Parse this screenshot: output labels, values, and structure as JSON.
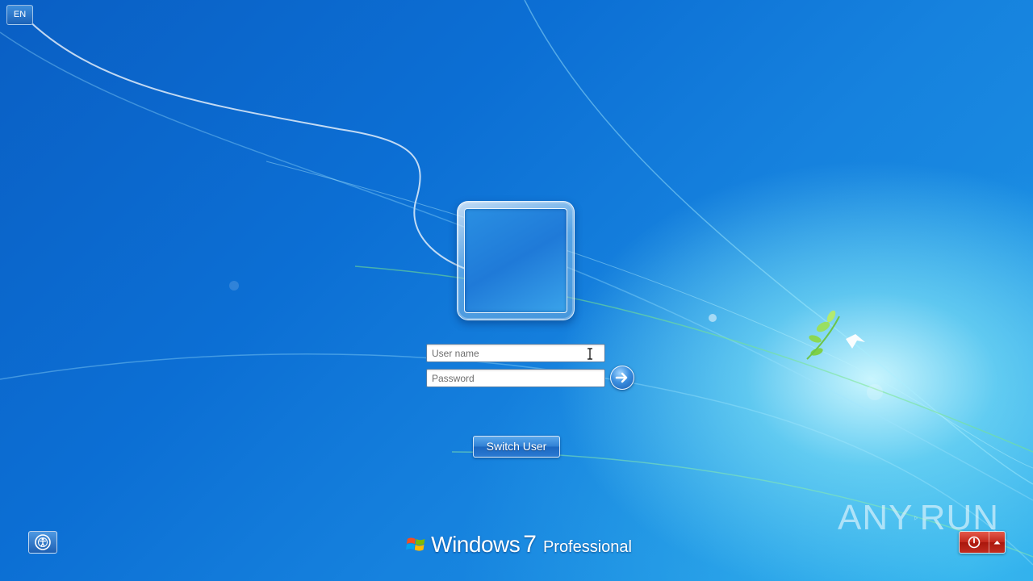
{
  "language_bar": {
    "label": "EN"
  },
  "login": {
    "username_placeholder": "User name",
    "password_placeholder": "Password",
    "submit_icon": "arrow-right-icon",
    "switch_user_label": "Switch User"
  },
  "branding": {
    "product": "Windows",
    "version": "7",
    "edition": "Professional"
  },
  "watermark": {
    "left": "ANY",
    "right": "RUN"
  },
  "icons": {
    "ease_of_access": "ease-of-access-icon",
    "power": "power-icon",
    "power_menu": "chevron-up-icon"
  },
  "colors": {
    "background_blue": "#0c6fd4",
    "power_red": "#c2261a",
    "button_blue": "#2f7fd4"
  }
}
